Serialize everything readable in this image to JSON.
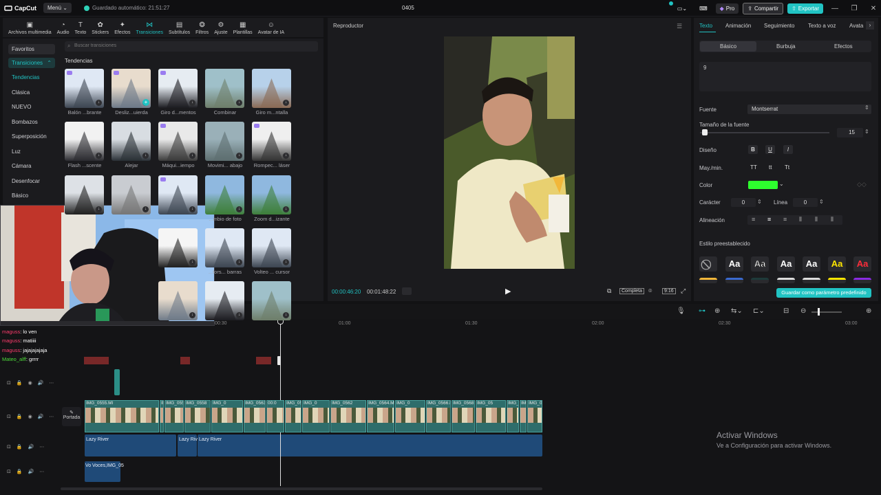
{
  "titlebar": {
    "app_name": "CapCut",
    "menu_label": "Menú",
    "autosave_text": "Guardado automático: 21:51:27",
    "project_name": "0405",
    "pro_label": "Pro",
    "share_label": "Compartir",
    "export_label": "Exportar"
  },
  "toolbar": {
    "tools": [
      {
        "label": "Archivos multimedia",
        "icon": "media-icon"
      },
      {
        "label": "Audio",
        "icon": "audio-icon"
      },
      {
        "label": "Texto",
        "icon": "text-icon"
      },
      {
        "label": "Stickers",
        "icon": "sticker-icon"
      },
      {
        "label": "Efectos",
        "icon": "effects-icon"
      },
      {
        "label": "Transiciones",
        "icon": "transitions-icon"
      },
      {
        "label": "Subtítulos",
        "icon": "subtitles-icon"
      },
      {
        "label": "Filtros",
        "icon": "filters-icon"
      },
      {
        "label": "Ajuste",
        "icon": "adjust-icon"
      },
      {
        "label": "Plantillas",
        "icon": "templates-icon"
      },
      {
        "label": "Avatar de IA",
        "icon": "ai-avatar-icon"
      }
    ],
    "active_index": 5
  },
  "categories": {
    "favorites": "Favoritos",
    "transitions": "Transiciones",
    "items": [
      "Tendencias",
      "Clásica",
      "NUEVO",
      "Bombazos",
      "Superposición",
      "Luz",
      "Cámara",
      "Desenfocar",
      "Básico"
    ],
    "selected": "Tendencias"
  },
  "search": {
    "placeholder": "Buscar transiciones"
  },
  "section_title": "Tendencias",
  "transitions": [
    {
      "label": "Balón ...brante"
    },
    {
      "label": "Desliz...uierda"
    },
    {
      "label": "Giro d...mentos"
    },
    {
      "label": "Combinar"
    },
    {
      "label": "Giro m...ntalla"
    },
    {
      "label": "Flash ...scente"
    },
    {
      "label": "Alejar"
    },
    {
      "label": "Máqui...iempo"
    },
    {
      "label": "Movimi... abajo"
    },
    {
      "label": "Rompec... láser"
    },
    {
      "label": "...mbio de foto"
    },
    {
      "label": "Zoom d...izante"
    },
    {
      "label": "...tors... barras"
    },
    {
      "label": "Volteo ... cursor"
    }
  ],
  "chat": [
    {
      "user": "maguss",
      "msg": ": lo ven"
    },
    {
      "user": "maguss",
      "msg": ": matiiii"
    },
    {
      "user": "maguss",
      "msg": ": jajajajajaja"
    },
    {
      "user": "Mateo_alff",
      "msg": ": grrrr"
    }
  ],
  "player": {
    "title": "Reproductor",
    "current_time": "00:00:46:20",
    "total_time": "00:01:48:22",
    "view_mode": "Completa",
    "ratio": "9:16"
  },
  "rightpanel": {
    "tabs": [
      "Texto",
      "Animación",
      "Seguimiento",
      "Texto a voz",
      "Avata"
    ],
    "subtabs": [
      "Básico",
      "Burbuja",
      "Efectos"
    ],
    "text_value": "9",
    "font_label": "Fuente",
    "font_value": "Montserrat",
    "size_label": "Tamaño de la fuente",
    "size_value": "15",
    "design_label": "Diseño",
    "case_label": "May./min.",
    "case_options": [
      "TT",
      "tt",
      "Tt"
    ],
    "color_label": "Color",
    "color_value": "#2eff2e",
    "char_label": "Carácter",
    "char_value": "0",
    "line_label": "Línea",
    "line_value": "0",
    "align_label": "Alineación",
    "preset_label": "Estilo preestablecido",
    "style_sample": "Aa",
    "save_preset": "Guardar como parámetro predefinido"
  },
  "timeline": {
    "ruler": [
      "00:30",
      "01:00",
      "01:30",
      "02:00",
      "02:30",
      "03:00"
    ],
    "cover_label": "Portada",
    "clip_labels": [
      "IMG_0555.MI",
      "IMG_0556",
      "IMG_0557",
      "IMG_0558",
      "IMG_0",
      "IMG_0563.MOV",
      "00:0",
      "IMG_056",
      "IMG_0",
      "IMG_0562",
      "IMG_0564.MOV",
      "IMG_0",
      "IMG_0566.MOV",
      "IMG_0568.MOV",
      "IMG_05",
      "IMG_0570",
      "IMG_0",
      "IMG_0568.MOV",
      "IMG_0",
      "IMG_0"
    ],
    "audio_labels": [
      "Lazy River",
      "Lazy Riv",
      "Lazy River"
    ],
    "voice_labels": [
      "Vo",
      "Voces,IMG_05"
    ]
  },
  "watermark": {
    "line1": "Activar Windows",
    "line2": "Ve a Configuración para activar Windows."
  }
}
